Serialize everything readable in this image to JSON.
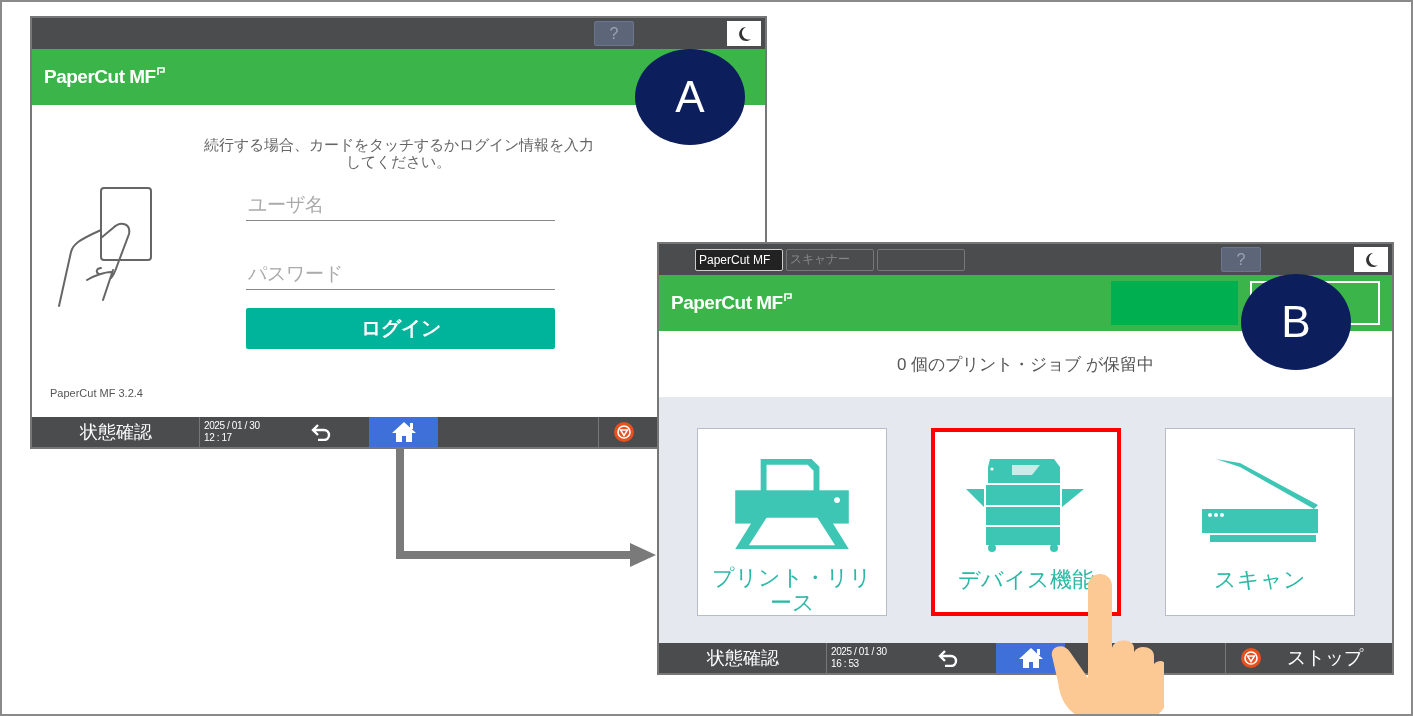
{
  "callouts": [
    {
      "label": "A"
    },
    {
      "label": "B"
    }
  ],
  "login_screen": {
    "help": "?",
    "logo": "PaperCut MF",
    "prompt": "続行する場合、カードをタッチするかログイン情報を入力してください。",
    "username": {
      "placeholder": "ユーザ名"
    },
    "password": {
      "placeholder": "パスワード"
    },
    "login_button": "ログイン",
    "version": "PaperCut MF 3.2.4",
    "status_bar": {
      "status": "状態確認",
      "date": "2025 / 01 / 30",
      "time": "12 : 17"
    }
  },
  "home_screen": {
    "app_tabs": [
      {
        "label": "PaperCut MF",
        "selected": true
      },
      {
        "label": "スキャナー",
        "selected": false
      }
    ],
    "help": "?",
    "logo": "PaperCut MF",
    "held_jobs": "0 個のプリント・ジョブ が保留中",
    "tiles": [
      {
        "kind": "printer",
        "label": "プリント・リリース",
        "highlighted": false
      },
      {
        "kind": "copier",
        "label": "デバイス機能",
        "highlighted": true
      },
      {
        "kind": "scanner",
        "label": "スキャン",
        "highlighted": false
      }
    ],
    "status_bar": {
      "status": "状態確認",
      "date": "2025 / 01 / 30",
      "time": "16 : 53",
      "stop": "ストップ"
    }
  }
}
